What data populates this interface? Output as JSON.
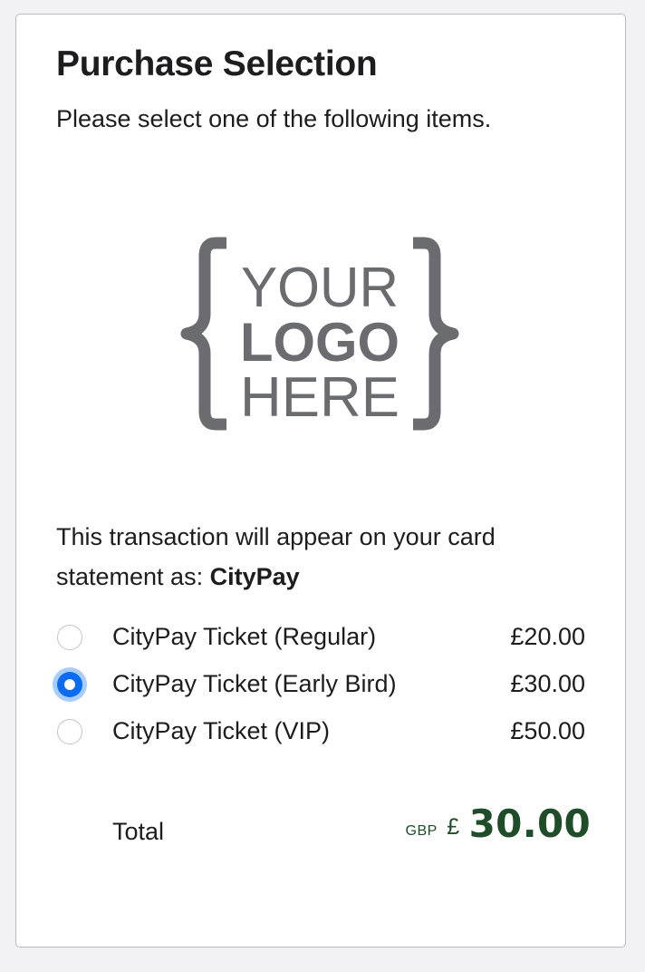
{
  "page": {
    "title": "Purchase Selection",
    "subtitle": "Please select one of the following items."
  },
  "logo": {
    "lines": [
      "YOUR",
      "LOGO",
      "HERE"
    ],
    "color": "#6b6c6f"
  },
  "statement": {
    "prefix": "This transaction will appear on your card statement as:",
    "merchant": "CityPay"
  },
  "options": [
    {
      "label": "CityPay Ticket (Regular)",
      "price": "£20.00",
      "selected": false
    },
    {
      "label": "CityPay Ticket (Early Bird)",
      "price": "£30.00",
      "selected": true
    },
    {
      "label": "CityPay Ticket (VIP)",
      "price": "£50.00",
      "selected": false
    }
  ],
  "total": {
    "label": "Total",
    "currency_code": "GBP",
    "currency_symbol": "£",
    "amount": "30.00",
    "color": "#1f4d2a"
  },
  "colors": {
    "radio_selected": "#0a6cf0",
    "radio_focus_ring": "#a8cdfb"
  }
}
